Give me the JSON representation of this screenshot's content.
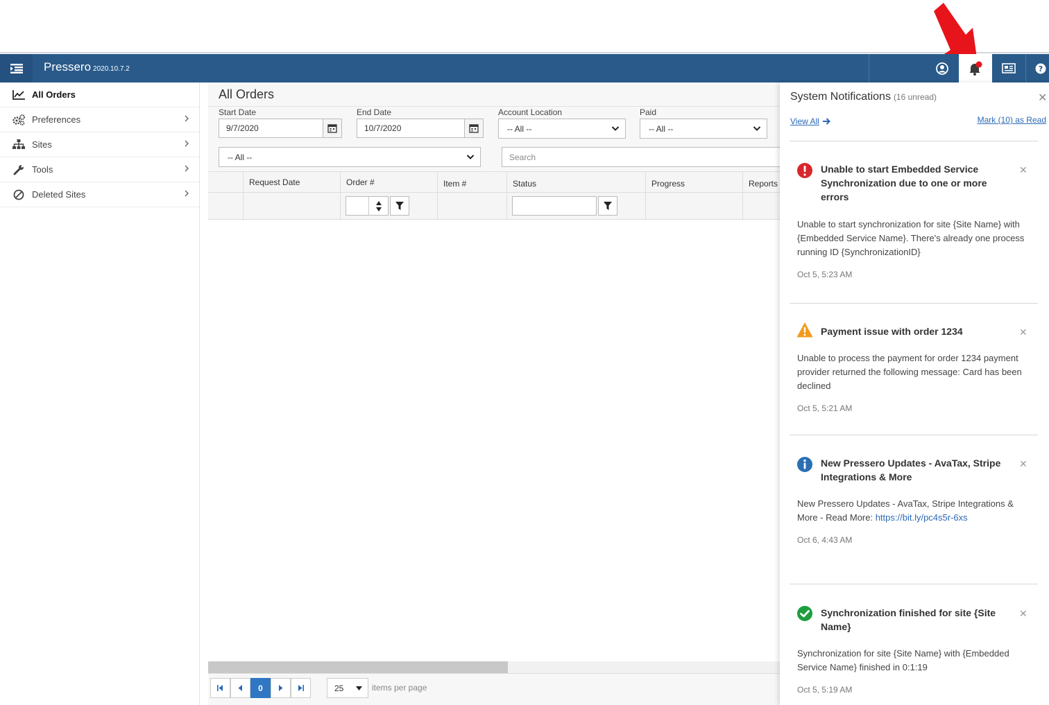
{
  "app": {
    "name": "Pressero",
    "version": "2020.10.7.2"
  },
  "sidebar": {
    "items": [
      {
        "label": "All Orders",
        "icon": "chart-line-icon",
        "active": true
      },
      {
        "label": "Preferences",
        "icon": "gears-icon"
      },
      {
        "label": "Sites",
        "icon": "sitemap-icon"
      },
      {
        "label": "Tools",
        "icon": "wrench-icon"
      },
      {
        "label": "Deleted Sites",
        "icon": "ban-icon"
      }
    ]
  },
  "main": {
    "title": "All Orders",
    "filters": {
      "start_date_label": "Start Date",
      "start_date_value": "9/7/2020",
      "end_date_label": "End Date",
      "end_date_value": "10/7/2020",
      "account_location_label": "Account Location",
      "account_location_value": "-- All --",
      "paid_label": "Paid",
      "paid_value": "-- All --",
      "second_select_value": "-- All --",
      "search_placeholder": "Search"
    },
    "grid": {
      "columns": [
        "Request Date",
        "Order #",
        "Item #",
        "Status",
        "Progress",
        "Reports"
      ]
    },
    "pager": {
      "current_page": "0",
      "page_size": "25",
      "page_size_label": "items per page"
    }
  },
  "notifications": {
    "title": "System Notifications",
    "unread": "(16 unread)",
    "view_all": "View All",
    "mark_read": "Mark (10) as Read",
    "items": [
      {
        "type": "error",
        "title": "Unable to start Embedded Service Synchronization due to one or more errors",
        "body": "Unable to start synchronization for site {Site Name} with {Embedded Service Name}. There's already one process running ID {SynchronizationID}",
        "time": "Oct 5, 5:23 AM"
      },
      {
        "type": "warning",
        "title": "Payment issue with order 1234",
        "body": "Unable to process the payment for order 1234 payment provider returned the following message: Card has been declined",
        "time": "Oct 5, 5:21 AM"
      },
      {
        "type": "info",
        "title": "New Pressero Updates - AvaTax, Stripe Integrations & More",
        "body": "New Pressero Updates - AvaTax, Stripe Integrations & More - Read More: ",
        "link": "https://bit.ly/pc4s5r-6xs",
        "time": "Oct 6, 4:43 AM"
      },
      {
        "type": "success",
        "title": "Synchronization finished for site {Site Name}",
        "body": "Synchronization for site {Site Name} with {Embedded Service Name} finished in 0:1:19",
        "time": "Oct 5, 5:19 AM"
      }
    ]
  },
  "colors": {
    "topbar": "#295a8a",
    "accent": "#2f76c3",
    "link": "#2a69b6",
    "error": "#d9262c",
    "warning": "#f39a1c",
    "info": "#2a6fb5",
    "success": "#1e9e3e",
    "callout_arrow": "#e8141b"
  }
}
